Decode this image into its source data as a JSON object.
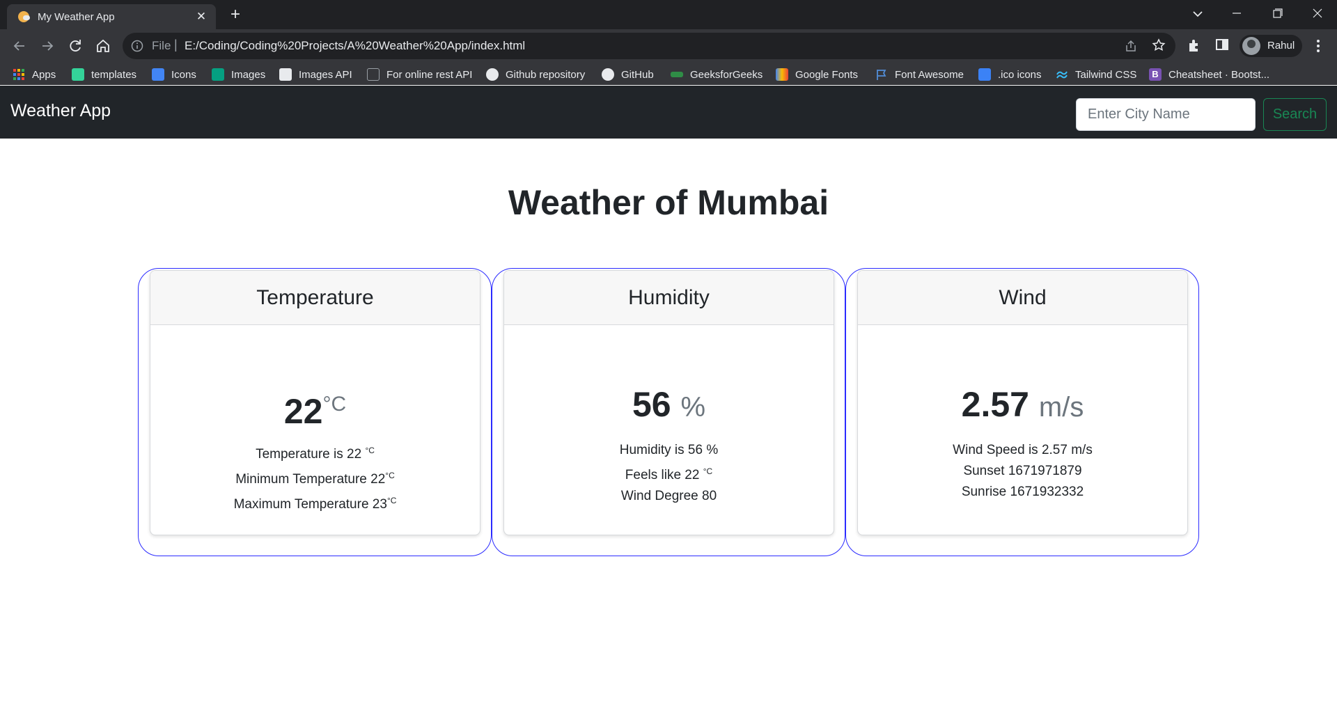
{
  "browser": {
    "tab_title": "My Weather App",
    "tab_close": "✕",
    "new_tab": "+",
    "scheme": "File",
    "url_separator": "|",
    "url": "E:/Coding/Coding%20Projects/A%20Weather%20App/index.html",
    "profile_name": "Rahul"
  },
  "bookmarks": [
    {
      "label": "Apps",
      "icon": "apps-grid-icon",
      "color": "#ea4335"
    },
    {
      "label": "templates",
      "icon": "templates-icon",
      "color": "#34d399"
    },
    {
      "label": "Icons",
      "icon": "icons-icon",
      "color": "#4285f4"
    },
    {
      "label": "Images",
      "icon": "pexels-icon",
      "color": "#05a081"
    },
    {
      "label": "Images API",
      "icon": "unsplash-icon",
      "color": "#ffffff"
    },
    {
      "label": "For online rest API",
      "icon": "rest-api-icon",
      "color": "#9aa0a6"
    },
    {
      "label": "Github repository",
      "icon": "github-icon",
      "color": "#ffffff"
    },
    {
      "label": "GitHub",
      "icon": "github-icon",
      "color": "#ffffff"
    },
    {
      "label": "GeeksforGeeks",
      "icon": "geeksforgeeks-icon",
      "color": "#2f8d46"
    },
    {
      "label": "Google Fonts",
      "icon": "google-fonts-icon",
      "color": "#fbbc04"
    },
    {
      "label": "Font Awesome",
      "icon": "flag-icon",
      "color": "#528dd7"
    },
    {
      "label": ".ico icons",
      "icon": "ico-icon",
      "color": "#3b82f6"
    },
    {
      "label": "Tailwind CSS",
      "icon": "tailwind-icon",
      "color": "#38bdf8"
    },
    {
      "label": "Cheatsheet · Bootst...",
      "icon": "bootstrap-icon",
      "color": "#7952b3"
    }
  ],
  "navbar": {
    "brand": "Weather App",
    "search_placeholder": "Enter City Name",
    "search_label": "Search"
  },
  "page": {
    "title": "Weather of Mumbai"
  },
  "cards": {
    "temperature": {
      "header": "Temperature",
      "big_value": "22",
      "big_unit": "°C",
      "line1": "Temperature is 22 ",
      "line1_unit": "°C",
      "line2": "Minimum Temperature 22",
      "line2_unit": "°C",
      "line3": "Maximum Temperature 23",
      "line3_unit": "°C"
    },
    "humidity": {
      "header": "Humidity",
      "big_value": "56",
      "big_unit": "%",
      "line1": "Humidity is 56 %",
      "line2": "Feels like 22 ",
      "line2_unit": "°C",
      "line3": "Wind Degree 80"
    },
    "wind": {
      "header": "Wind",
      "big_value": "2.57",
      "big_unit": "m/s",
      "line1": "Wind Speed is 2.57 m/s",
      "line2": "Sunset 1671971879",
      "line3": "Sunrise 1671932332"
    }
  },
  "colors": {
    "navbar_bg": "#212529",
    "search_accent": "#198754",
    "card_outline": "#2b2bff"
  }
}
